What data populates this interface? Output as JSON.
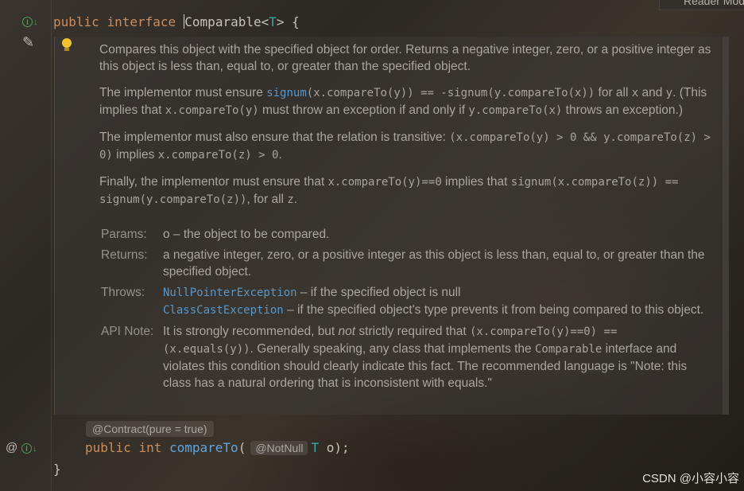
{
  "editor": {
    "reader_mode_label": "Reader Mode",
    "line1": {
      "kw1": "public",
      "kw2": "interface",
      "class_name": "Comparable",
      "lt": "<",
      "type_param": "T",
      "gt": ">",
      "brace": " {"
    },
    "annotation": "@Contract(pure = true)",
    "method_line": {
      "kw1": "public",
      "kw2": "int",
      "method": "compareTo",
      "open": "(",
      "param_anno": "@NotNull",
      "param_type": "T",
      "param_name": "o",
      "close": ");"
    },
    "closing_brace": "}"
  },
  "gutter": {
    "icons": [
      "implemented-interface-icon",
      "edit-pencil-icon",
      "annotation-at-icon",
      "implemented-method-icon"
    ],
    "impl_glyph": "I",
    "arrow_glyph": "↓",
    "pencil_glyph": "✎",
    "at_glyph": "@"
  },
  "doc": {
    "p1": "Compares this object with the specified object for order. Returns a negative integer, zero, or a positive integer as this object is less than, equal to, or greater than the specified object.",
    "p2": {
      "t1": "The implementor must ensure ",
      "link1": "signum",
      "c1": "(x.compareTo(y)) == -signum(y.compareTo(x))",
      "t2": " for all ",
      "c2": "x",
      "t3": " and ",
      "c3": "y",
      "t4": ". (This implies that ",
      "c4": "x.compareTo(y)",
      "t5": " must throw an exception if and only if ",
      "c5": "y.compareTo(x)",
      "t6": " throws an exception.)"
    },
    "p3": {
      "t1": "The implementor must also ensure that the relation is transitive: ",
      "c1": "(x.compareTo(y) > 0 && y.compareTo(z) > 0)",
      "t2": " implies ",
      "c2": "x.compareTo(z) > 0",
      "t3": "."
    },
    "p4": {
      "t1": "Finally, the implementor must ensure that ",
      "c1": "x.compareTo(y)==0",
      "t2": " implies that ",
      "c2": "signum(x.compareTo(z)) == signum(y.compareTo(z))",
      "t3": ", for all ",
      "c3": "z",
      "t4": "."
    },
    "params_label": "Params:",
    "params_value": "o – the object to be compared.",
    "returns_label": "Returns:",
    "returns_value": "a negative integer, zero, or a positive integer as this object is less than, equal to, or greater than the specified object.",
    "throws_label": "Throws:",
    "throws": [
      {
        "exception": "NullPointerException",
        "desc": " – if the specified object is null"
      },
      {
        "exception": "ClassCastException",
        "desc": " – if the specified object's type prevents it from being compared to this object."
      }
    ],
    "api_note_label": "API Note:",
    "api_note": {
      "t1": "It is strongly recommended, but ",
      "em": "not",
      "t2": " strictly required that ",
      "c1": "(x.compareTo(y)==0) == (x.equals(y))",
      "t3": ". Generally speaking, any class that implements the ",
      "c2": "Comparable",
      "t4": " interface and violates this condition should clearly indicate this fact. The recommended language is \"Note: this class has a natural ordering that is inconsistent with equals.\""
    }
  },
  "watermark": "CSDN @小容小容",
  "colors": {
    "keyword": "#cc8d5b",
    "type_param": "#3ea4a8",
    "method": "#5fa5e0",
    "link": "#5897c8",
    "bulb": "#f2c230",
    "gutter_icon": "#4e9a5c"
  }
}
